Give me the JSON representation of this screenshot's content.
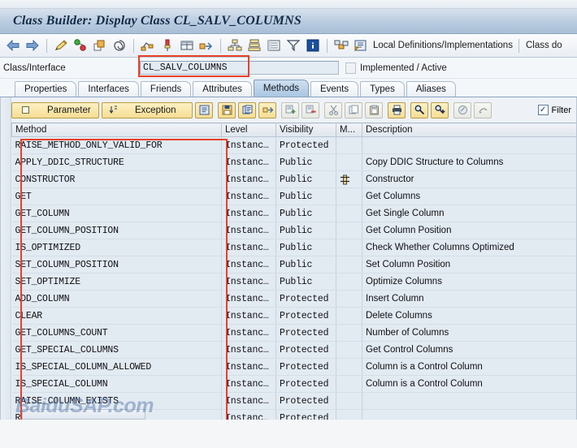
{
  "window": {
    "title": "Class Builder: Display Class CL_SALV_COLUMNS"
  },
  "toolbar": {
    "items": [
      {
        "name": "back-arrow-icon",
        "label": ""
      },
      {
        "name": "forward-arrow-icon",
        "label": ""
      },
      {
        "name": "pencil-edit-icon",
        "label": ""
      },
      {
        "name": "check-syntax-icon",
        "label": ""
      },
      {
        "name": "activate-icon",
        "label": ""
      },
      {
        "name": "pattern-icon",
        "label": ""
      },
      {
        "name": "where-used-list-icon",
        "label": ""
      },
      {
        "name": "pin-icon",
        "label": ""
      },
      {
        "name": "display-object-list-icon",
        "label": ""
      },
      {
        "name": "navigate-icon",
        "label": ""
      },
      {
        "name": "class-hierarchy-icon",
        "label": ""
      },
      {
        "name": "inheritance-icon",
        "label": ""
      },
      {
        "name": "list-icon",
        "label": ""
      },
      {
        "name": "filter-icon",
        "label": ""
      },
      {
        "name": "info-icon",
        "label": ""
      },
      {
        "name": "refactor-icon",
        "label": ""
      },
      {
        "name": "local-definitions-icon",
        "label": ""
      }
    ],
    "local_definitions_label": "Local Definitions/Implementations",
    "class_documentation_label": "Class do"
  },
  "class_row": {
    "label": "Class/Interface",
    "value": "CL_SALV_COLUMNS",
    "status": "Implemented / Active"
  },
  "tabs": [
    {
      "label": "Properties",
      "selected": false
    },
    {
      "label": "Interfaces",
      "selected": false
    },
    {
      "label": "Friends",
      "selected": false
    },
    {
      "label": "Attributes",
      "selected": false
    },
    {
      "label": "Methods",
      "selected": true
    },
    {
      "label": "Events",
      "selected": false
    },
    {
      "label": "Types",
      "selected": false
    },
    {
      "label": "Aliases",
      "selected": false
    }
  ],
  "button_bar": {
    "parameter_label": "Parameter",
    "exception_label": "Exception",
    "filter_label": "Filter",
    "filter_checked": true,
    "icons": [
      {
        "name": "method-documentation-icon"
      },
      {
        "name": "save-layout-icon"
      },
      {
        "name": "copy-method-icon"
      },
      {
        "name": "expand-icon"
      },
      {
        "name": "insert-row-icon"
      },
      {
        "name": "delete-row-icon"
      },
      {
        "name": "cut-icon"
      },
      {
        "name": "copy-icon"
      },
      {
        "name": "paste-icon"
      },
      {
        "name": "print-icon"
      },
      {
        "name": "find-icon"
      },
      {
        "name": "find-next-icon"
      },
      {
        "name": "redefine-icon"
      },
      {
        "name": "undo-redefine-icon"
      }
    ]
  },
  "table": {
    "columns": [
      "Method",
      "Level",
      "Visibility",
      "M...",
      "Description"
    ],
    "rows": [
      {
        "method": "RAISE_METHOD_ONLY_VALID_FOR",
        "level": "Instanc…",
        "visibility": "Protected",
        "m": "",
        "description": ""
      },
      {
        "method": "APPLY_DDIC_STRUCTURE",
        "level": "Instanc…",
        "visibility": "Public",
        "m": "",
        "description": "Copy DDIC Structure to Columns"
      },
      {
        "method": "CONSTRUCTOR",
        "level": "Instanc…",
        "visibility": "Public",
        "m": "hierarchy-icon",
        "description": "Constructor"
      },
      {
        "method": "GET",
        "level": "Instanc…",
        "visibility": "Public",
        "m": "",
        "description": "Get Columns"
      },
      {
        "method": "GET_COLUMN",
        "level": "Instanc…",
        "visibility": "Public",
        "m": "",
        "description": "Get Single Column"
      },
      {
        "method": "GET_COLUMN_POSITION",
        "level": "Instanc…",
        "visibility": "Public",
        "m": "",
        "description": "Get Column Position"
      },
      {
        "method": "IS_OPTIMIZED",
        "level": "Instanc…",
        "visibility": "Public",
        "m": "",
        "description": "Check Whether Columns Optimized"
      },
      {
        "method": "SET_COLUMN_POSITION",
        "level": "Instanc…",
        "visibility": "Public",
        "m": "",
        "description": "Set Column Position"
      },
      {
        "method": "SET_OPTIMIZE",
        "level": "Instanc…",
        "visibility": "Public",
        "m": "",
        "description": "Optimize Columns"
      },
      {
        "method": "ADD_COLUMN",
        "level": "Instanc…",
        "visibility": "Protected",
        "m": "",
        "description": "Insert Column"
      },
      {
        "method": "CLEAR",
        "level": "Instanc…",
        "visibility": "Protected",
        "m": "",
        "description": "Delete Columns"
      },
      {
        "method": "GET_COLUMNS_COUNT",
        "level": "Instanc…",
        "visibility": "Protected",
        "m": "",
        "description": "Number of Columns"
      },
      {
        "method": "GET_SPECIAL_COLUMNS",
        "level": "Instanc…",
        "visibility": "Protected",
        "m": "",
        "description": "Get Control Columns"
      },
      {
        "method": "IS_SPECIAL_COLUMN_ALLOWED",
        "level": "Instanc…",
        "visibility": "Protected",
        "m": "",
        "description": "Column is a Control Column"
      },
      {
        "method": "IS_SPECIAL_COLUMN",
        "level": "Instanc…",
        "visibility": "Protected",
        "m": "",
        "description": "Column is a Control Column"
      },
      {
        "method": "RAISE_COLUMN_EXISTS",
        "level": "Instanc…",
        "visibility": "Protected",
        "m": "",
        "description": ""
      },
      {
        "method": "RAISE_COLUMN_NOT_FOUND",
        "level": "Instanc…",
        "visibility": "Protected",
        "m": "",
        "description": ""
      }
    ]
  },
  "watermark": {
    "text": "BaiduSAP.com"
  },
  "colors": {
    "highlight_red": "#e8402a",
    "tab_selected": "#a9c6e2",
    "button_yellow": "#f6dd92",
    "row_bg": "#e2eaf2"
  }
}
